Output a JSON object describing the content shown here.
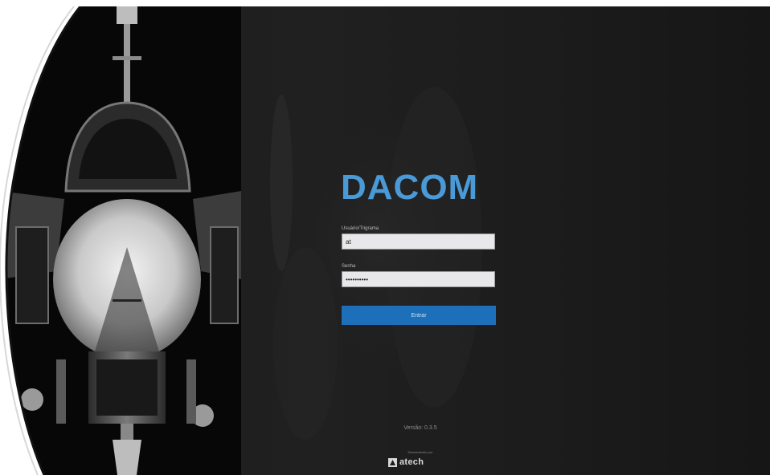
{
  "app": {
    "title": "DACOM"
  },
  "login": {
    "user_label": "Usuário/Trigrama",
    "user_value": "at",
    "password_label": "Senha",
    "password_value": "••••••••••",
    "submit_label": "Entrar"
  },
  "footer": {
    "version": "Versão: 0.3.5",
    "developed_by": "Desenvolvido por",
    "developer_logo": "atech"
  },
  "colors": {
    "brand": "#4a9ad8",
    "button": "#1c6fb8",
    "background": "#1c1c1c"
  },
  "icons": {
    "hero": "jet-fighter-image",
    "developer": "atech-logo-icon"
  }
}
